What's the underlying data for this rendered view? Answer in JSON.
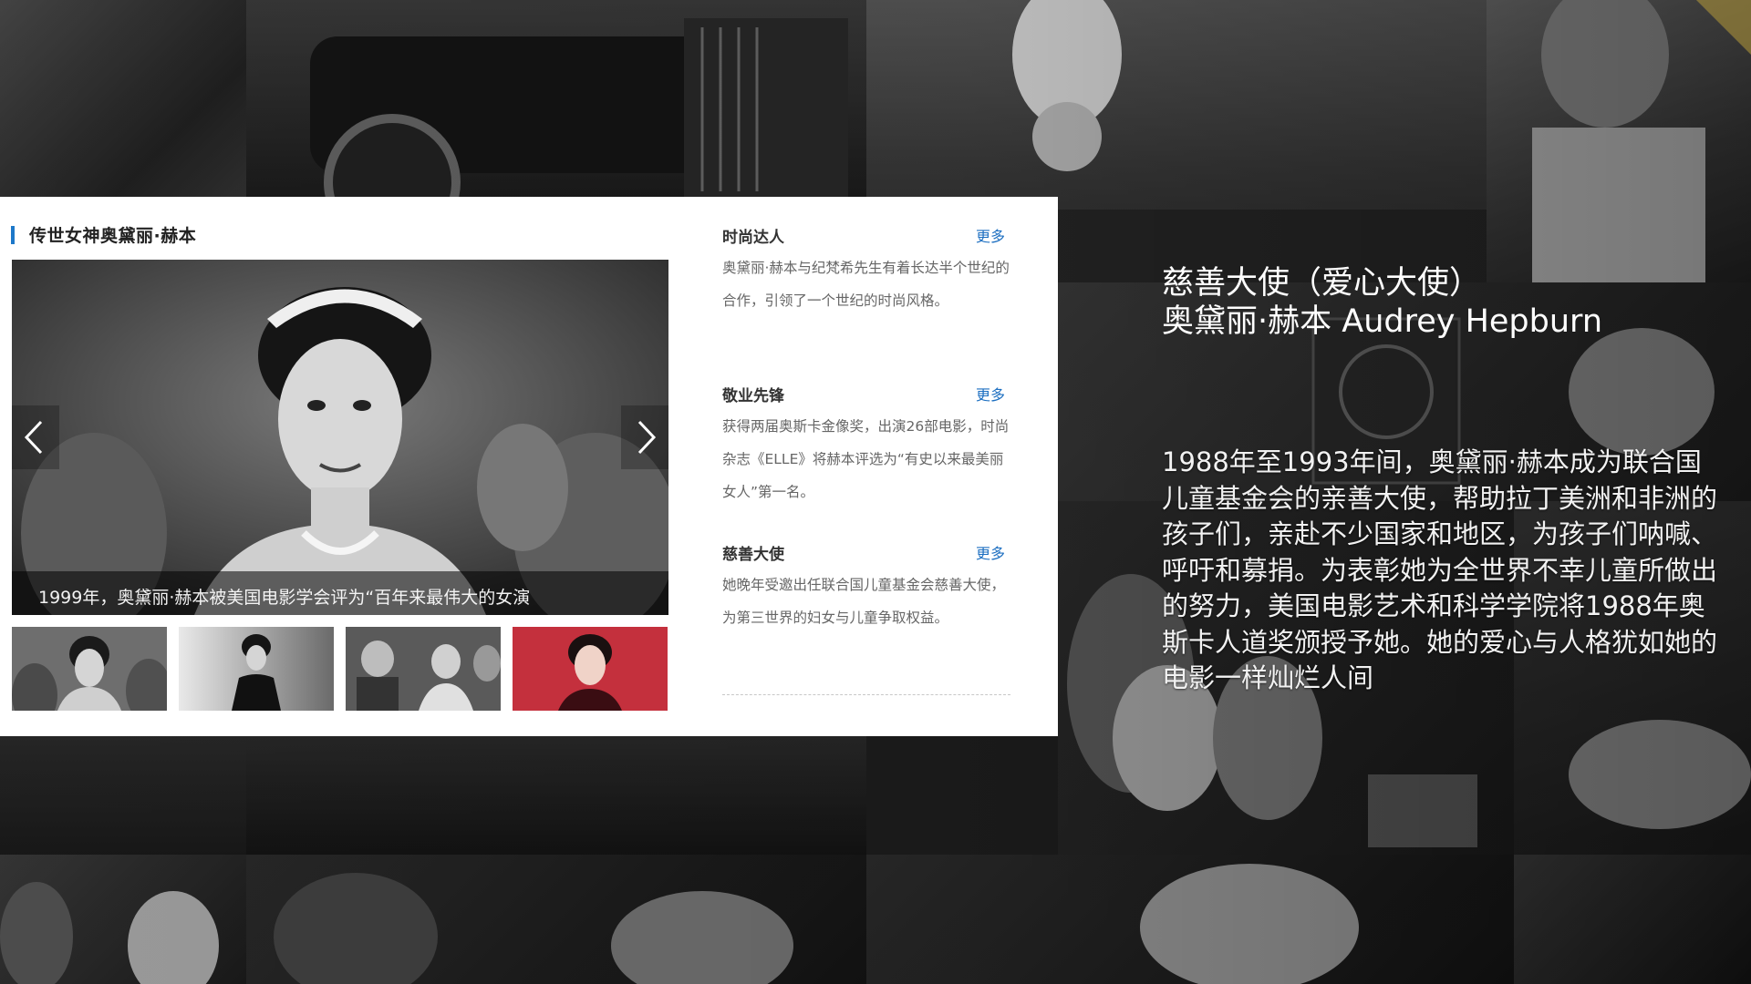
{
  "slide_panel": {
    "title": "传世女神奥黛丽·赫本",
    "caption": "1999年，奥黛丽·赫本被美国电影学会评为“百年来最伟大的女演",
    "thumbnails": [
      {
        "name": "thumb-tiara-portrait"
      },
      {
        "name": "thumb-black-dress"
      },
      {
        "name": "thumb-royal-ceremony"
      },
      {
        "name": "thumb-red-background"
      }
    ]
  },
  "sections": [
    {
      "title": "时尚达人",
      "more": "更多",
      "body": "奥黛丽·赫本与纪梵希先生有着长达半个世纪的合作，引领了一个世纪的时尚风格。"
    },
    {
      "title": "敬业先锋",
      "more": "更多",
      "body": "获得两届奥斯卡金像奖，出演26部电影，时尚杂志《ELLE》将赫本评选为“有史以来最美丽女人”第一名。"
    },
    {
      "title": "慈善大使",
      "more": "更多",
      "body": "她晚年受邀出任联合国儿童基金会慈善大使，为第三世界的妇女与儿童争取权益。"
    }
  ],
  "overlay": {
    "heading_line1": "慈善大使（爱心大使）",
    "heading_line2": "奥黛丽·赫本 Audrey Hepburn",
    "description": "1988年至1993年间，奥黛丽·赫本成为联合国儿童基金会的亲善大使，帮助拉丁美洲和非洲的孩子们，亲赴不少国家和地区，为孩子们呐喊、呼吁和募捐。为表彰她为全世界不幸儿童所做出的努力，美国电影艺术和科学学院将1988年奥斯卡人道奖颁授予她。她的爱心与人格犹如她的电影一样灿烂人间"
  },
  "icons": {
    "left": "chevron-left-icon",
    "right": "chevron-right-icon"
  },
  "colors": {
    "accent": "#1d78c9",
    "link": "#1d6fc1",
    "thumb_active_border": "#2f7fd3"
  }
}
